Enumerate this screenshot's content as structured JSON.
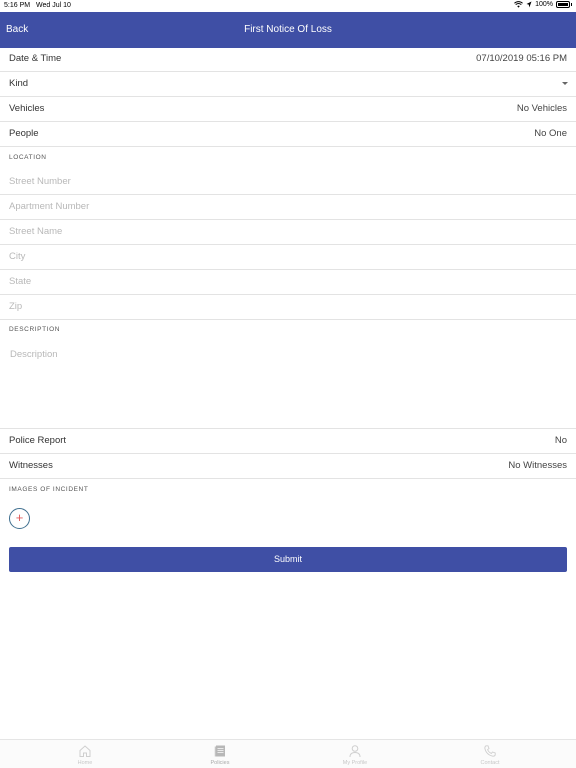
{
  "status_bar": {
    "time": "5:16 PM",
    "date": "Wed Jul 10",
    "battery": "100%",
    "battery_level": 1.0
  },
  "nav": {
    "back_label": "Back",
    "title": "First Notice Of Loss"
  },
  "fields": {
    "date_time": {
      "label": "Date & Time",
      "value": "07/10/2019 05:16 PM"
    },
    "kind": {
      "label": "Kind",
      "value": ""
    },
    "vehicles": {
      "label": "Vehicles",
      "value": "No Vehicles"
    },
    "people": {
      "label": "People",
      "value": "No One"
    }
  },
  "location": {
    "header": "LOCATION",
    "street_number": {
      "placeholder": "Street Number"
    },
    "apartment_number": {
      "placeholder": "Apartment Number"
    },
    "street_name": {
      "placeholder": "Street Name"
    },
    "city": {
      "placeholder": "City"
    },
    "state": {
      "placeholder": "State"
    },
    "zip": {
      "placeholder": "Zip"
    }
  },
  "description": {
    "header": "DESCRIPTION",
    "placeholder": "Description"
  },
  "police_report": {
    "label": "Police Report",
    "value": "No"
  },
  "witnesses": {
    "label": "Witnesses",
    "value": "No Witnesses"
  },
  "images": {
    "header": "IMAGES OF INCIDENT",
    "add_icon": "plus-icon"
  },
  "submit": {
    "label": "Submit"
  },
  "tabs": [
    {
      "label": "Home",
      "icon": "home-icon"
    },
    {
      "label": "Policies",
      "icon": "document-icon"
    },
    {
      "label": "My Profile",
      "icon": "person-icon"
    },
    {
      "label": "Contact",
      "icon": "phone-icon"
    }
  ],
  "colors": {
    "accent": "#3f4fa5",
    "add_plus": "#e05a5a",
    "placeholder": "#b8b8b8"
  }
}
